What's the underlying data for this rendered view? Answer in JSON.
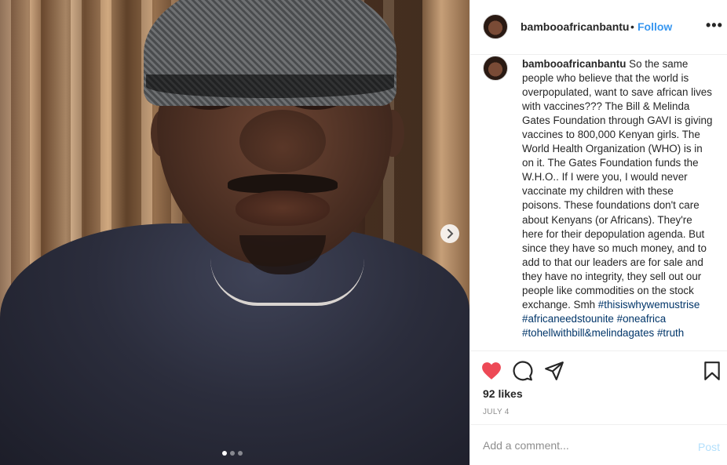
{
  "post": {
    "username": "bambooafricanbantu",
    "separator": "•",
    "follow_label": "Follow",
    "more_label": "•••",
    "caption_user": "bambooafricanbantu",
    "caption_text": " So the same people who believe that the world is overpopulated, want to save african lives with vaccines??? The Bill & Melinda Gates Foundation through GAVI is giving vaccines to 800,000 Kenyan girls. The World Health Organization (WHO) is in on it. The Gates Foundation funds the W.H.O.. If I were you, I would never vaccinate my children with these poisons. These foundations don't care about Kenyans (or Africans). They're here for their depopulation agenda. But since they have so much money, and to add to that our leaders are for sale and they have no integrity, they sell out our people like commodities on the stock exchange. Smh ",
    "hashtags": [
      "#thisiswhywemustrise",
      "#africaneedstounite",
      "#oneafrica",
      "#tohellwithbill&melindagates",
      "#truth"
    ],
    "likes": "92 likes",
    "date": "JULY 4",
    "liked": true
  },
  "comment_box": {
    "placeholder": "Add a comment...",
    "post_label": "Post"
  },
  "carousel": {
    "next_icon": "chevron-right-icon",
    "slides": 3,
    "current_slide": 1
  },
  "colors": {
    "like": "#ed4956",
    "link": "#3897f0",
    "hashtag": "#003569",
    "post_disabled": "#b2dffc"
  }
}
